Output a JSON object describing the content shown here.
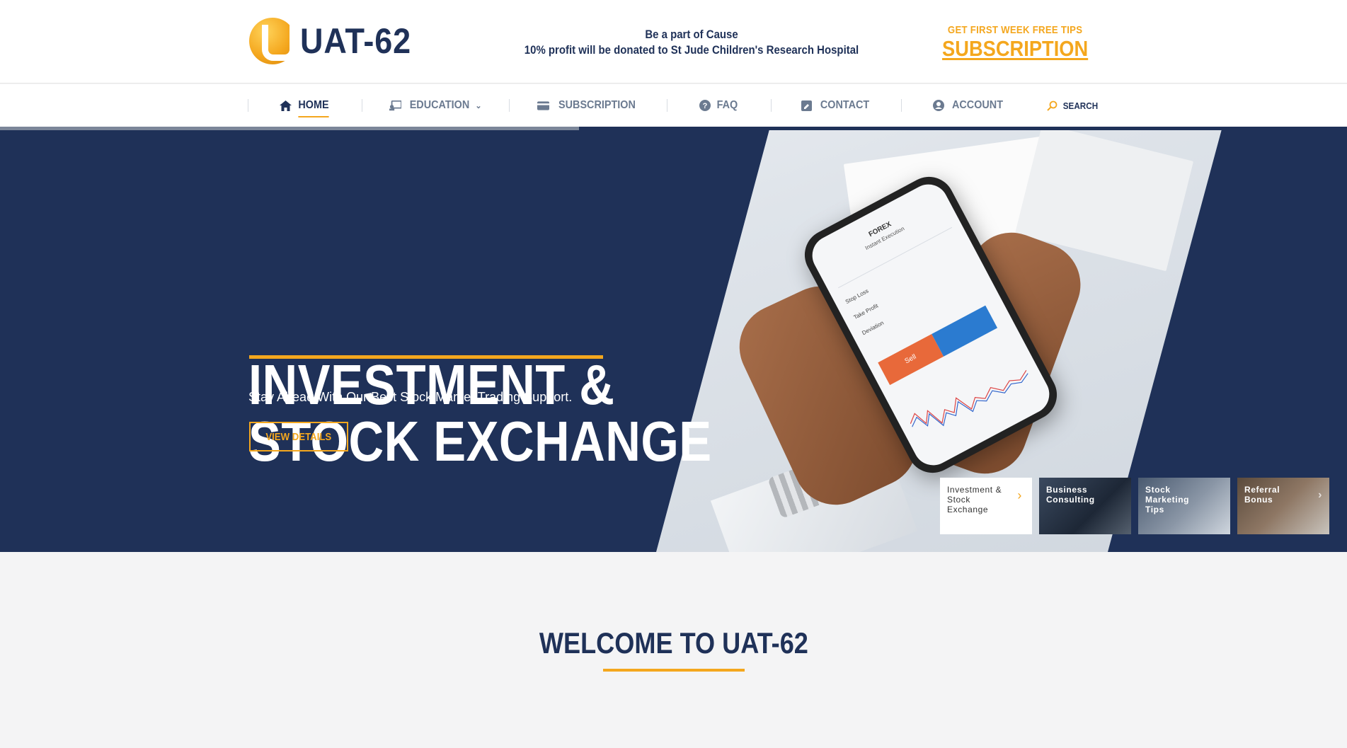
{
  "header": {
    "logo_text": "UAT-62",
    "cause_line1": "Be a part of Cause",
    "cause_line2": "10% profit will be donated to St Jude Children's Research Hospital",
    "promo_small": "GET FIRST WEEK FREE TIPS",
    "promo_big": "SUBSCRIPTION"
  },
  "nav": {
    "items": [
      {
        "label": "HOME",
        "icon": "home-icon",
        "active": true
      },
      {
        "label": "EDUCATION",
        "icon": "education-icon",
        "has_dropdown": true
      },
      {
        "label": "SUBSCRIPTION",
        "icon": "card-icon"
      },
      {
        "label": "FAQ",
        "icon": "question-circle-icon"
      },
      {
        "label": "CONTACT",
        "icon": "contact-icon"
      },
      {
        "label": "ACCOUNT",
        "icon": "user-circle-icon"
      }
    ],
    "search_label": "SEARCH"
  },
  "slider": {
    "progress": 0.43
  },
  "hero": {
    "title_line1": "INVESTMENT &",
    "title_line2": "STOCK EXCHANGE",
    "subtitle": "Stay Ahead With Our Best Stock Market Trading Support.",
    "button_label": "VIEW DETAILS",
    "thumbnails": [
      {
        "label": "Investment & Stock Exchange",
        "active": true
      },
      {
        "label": "Business Consulting"
      },
      {
        "label": "Stock Marketing Tips"
      },
      {
        "label": "Referral Bonus"
      }
    ],
    "phone_screen": {
      "header": "FOREX",
      "subheader": "Instant Execution",
      "rows": [
        "Stop Loss",
        "Take Profit",
        "Deviation"
      ],
      "sell_label": "Sell"
    }
  },
  "welcome": {
    "title": "WELCOME TO UAT-62"
  },
  "colors": {
    "navy": "#1f3158",
    "accent": "#f4a71e",
    "nav_text": "#6b7a90"
  }
}
